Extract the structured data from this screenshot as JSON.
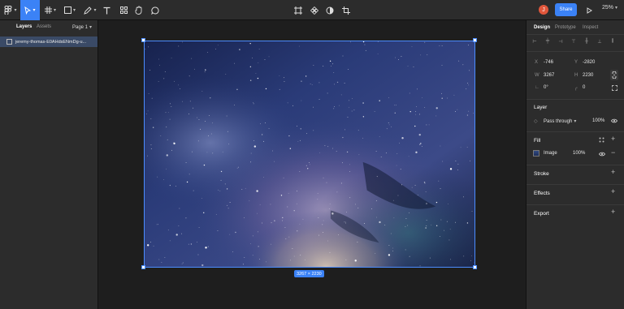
{
  "toolbar": {
    "tools": [
      "main-menu-icon",
      "move-tool-icon",
      "frame-tool-icon",
      "shape-tool-icon",
      "pen-tool-icon",
      "text-tool-icon",
      "resources-icon",
      "hand-tool-icon",
      "comment-tool-icon"
    ],
    "center_tools": [
      "crop-frame-icon",
      "component-icon",
      "contrast-icon",
      "crop-icon"
    ],
    "avatar_initial": "J",
    "share_label": "Share",
    "zoom_label": "25%",
    "accent": "#3b82f6"
  },
  "left_panel": {
    "tabs": [
      "Layers",
      "Assets"
    ],
    "page_label": "Page 1",
    "layers": [
      {
        "name": "jeremy-thomas-E0AHdsENmDg-u..."
      }
    ]
  },
  "canvas": {
    "size_label": "3267 × 2230",
    "help_label": "?"
  },
  "right_panel": {
    "tabs": [
      "Design",
      "Prototype",
      "Inspect"
    ],
    "x_label": "X",
    "x_value": "-746",
    "y_label": "Y",
    "y_value": "-2820",
    "w_label": "W",
    "w_value": "3267",
    "h_label": "H",
    "h_value": "2230",
    "rotation_value": "0°",
    "radius_value": "0",
    "layer_title": "Layer",
    "blend_mode": "Pass through",
    "layer_opacity": "100%",
    "fill_title": "Fill",
    "fill_type": "Image",
    "fill_opacity": "100%",
    "stroke_title": "Stroke",
    "effects_title": "Effects",
    "export_title": "Export"
  }
}
